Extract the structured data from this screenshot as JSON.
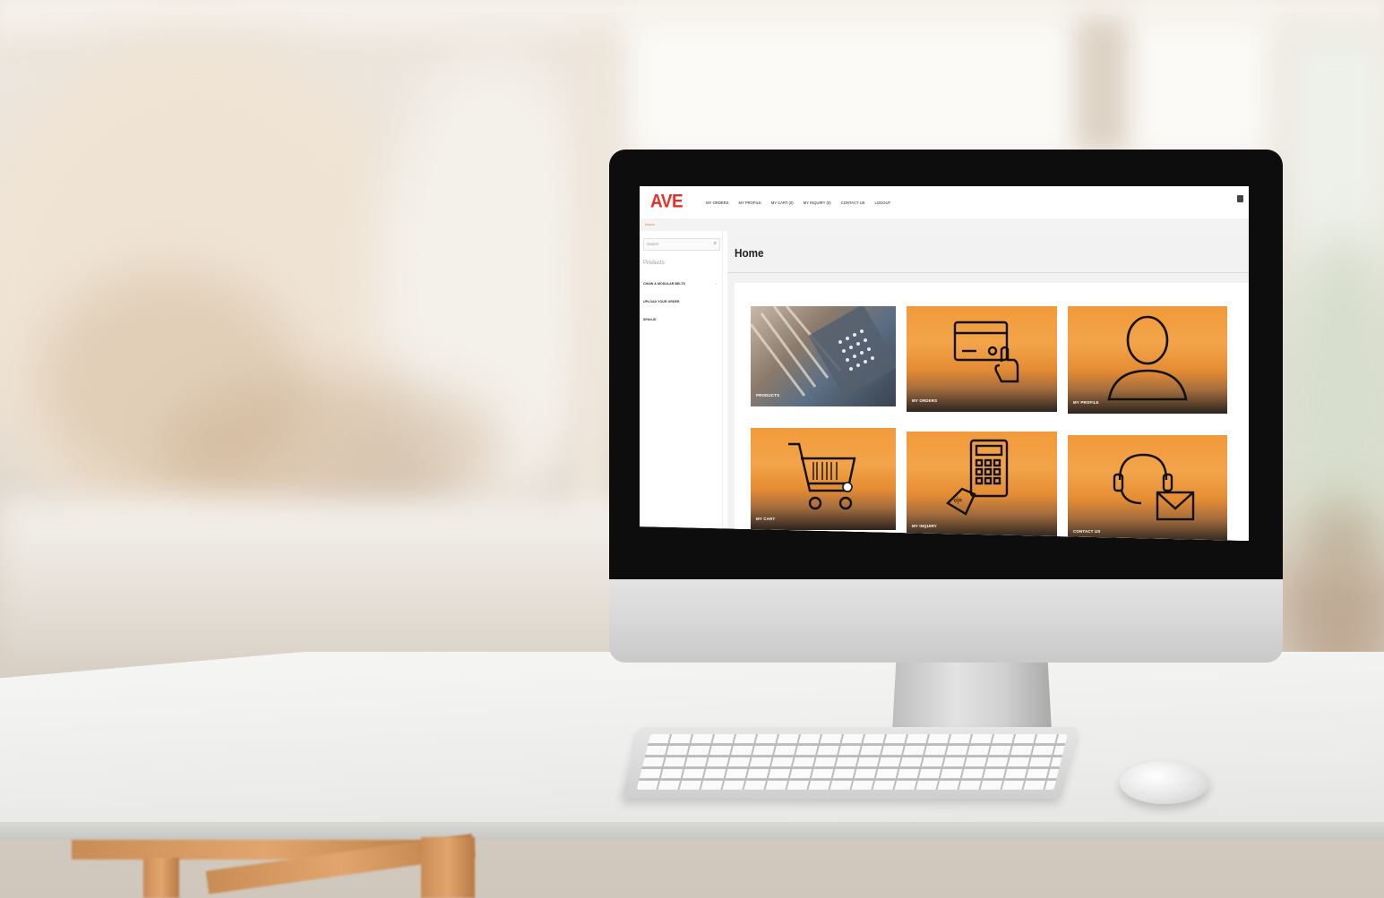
{
  "screen": {
    "logo": "AVE",
    "nav": [
      "MY ORDERS",
      "MY PROFILE",
      "MY CART (0)",
      "MY INQUIRY (0)",
      "CONTACT US",
      "LOGOUT"
    ],
    "breadcrumb": "Home",
    "sidebar": {
      "search_placeholder": "Search",
      "title": "Products",
      "items": [
        "CHAIN & MODULAR BELTS",
        "UPLOAD YOUR ORDER",
        "SPAN-ID"
      ]
    },
    "page_title": "Home",
    "tiles": [
      {
        "label": "PRODUCTS",
        "icon": "products-photo"
      },
      {
        "label": "MY ORDERS",
        "icon": "credit-card-icon"
      },
      {
        "label": "MY PROFILE",
        "icon": "user-icon"
      },
      {
        "label": "MY CART",
        "icon": "shopping-cart-icon"
      },
      {
        "label": "MY INQUIRY",
        "icon": "calculator-icon"
      },
      {
        "label": "CONTACT US",
        "icon": "headset-mail-icon"
      }
    ],
    "accent_color": "#ef7f1a",
    "logo_color": "#e4312b"
  }
}
